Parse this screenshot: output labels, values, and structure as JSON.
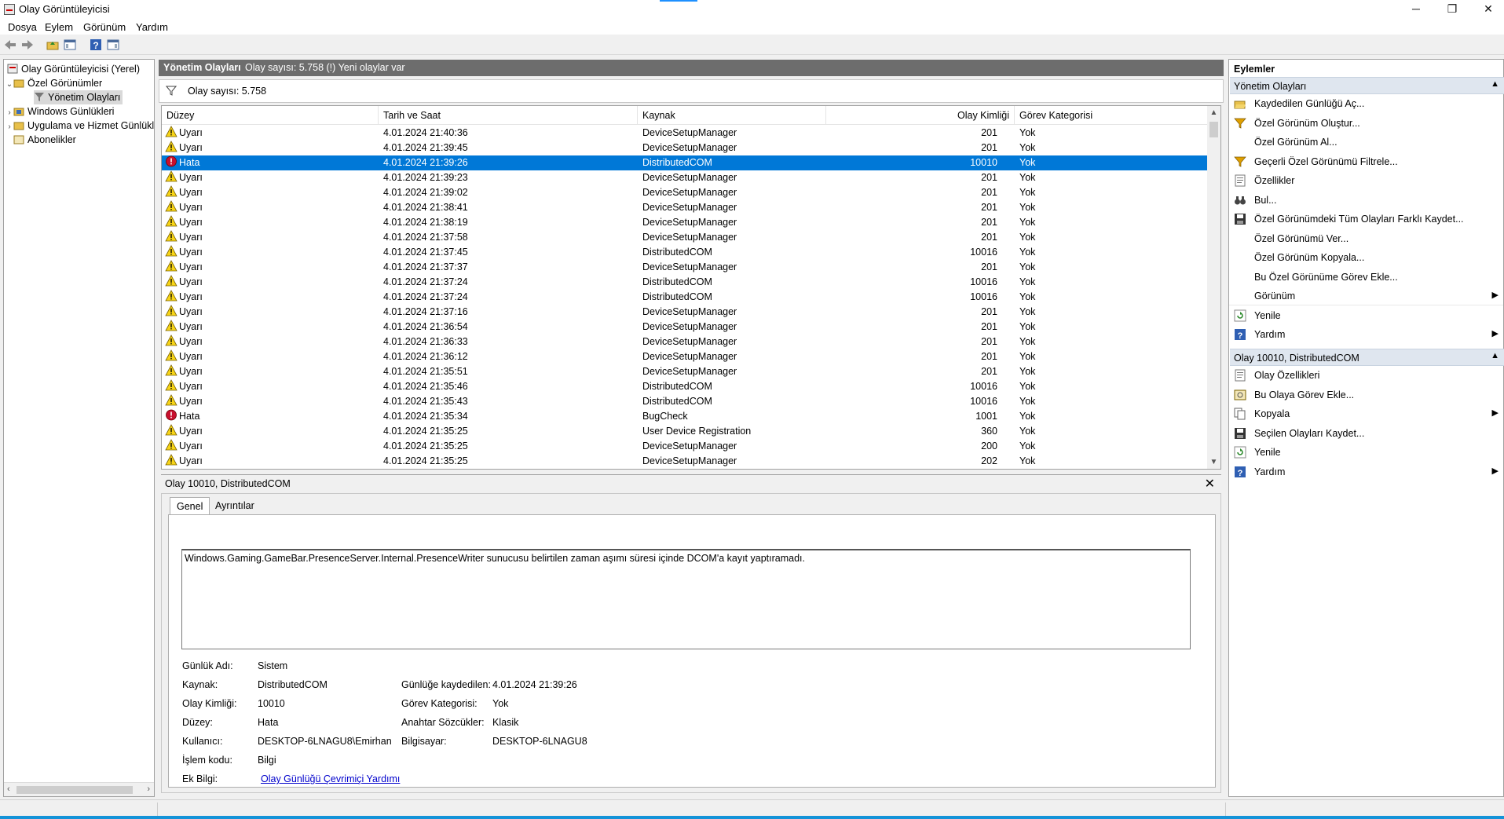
{
  "window": {
    "title": "Olay Görüntüleyicisi",
    "minimize": "─",
    "restore": "❐",
    "close": "✕"
  },
  "menu": [
    "Dosya",
    "Eylem",
    "Görünüm",
    "Yardım"
  ],
  "tree": {
    "root": "Olay Görüntüleyicisi (Yerel)",
    "custom_views": "Özel Görünümler",
    "admin_events": "Yönetim Olayları",
    "windows_logs": "Windows Günlükleri",
    "app_service_logs": "Uygulama ve Hizmet Günlükl",
    "subscriptions": "Abonelikler"
  },
  "center": {
    "header_title": "Yönetim Olayları",
    "header_count": "Olay sayısı: 5.758 (!) Yeni olaylar var",
    "filter_text": "Olay sayısı: 5.758",
    "columns": {
      "level": "Düzey",
      "datetime": "Tarih ve Saat",
      "source": "Kaynak",
      "event_id": "Olay Kimliği",
      "task": "Görev Kategorisi"
    },
    "rows": [
      {
        "level": "Uyarı",
        "type": "warn",
        "datetime": "4.01.2024 21:40:36",
        "source": "DeviceSetupManager",
        "id": "201",
        "task": "Yok"
      },
      {
        "level": "Uyarı",
        "type": "warn",
        "datetime": "4.01.2024 21:39:45",
        "source": "DeviceSetupManager",
        "id": "201",
        "task": "Yok"
      },
      {
        "level": "Hata",
        "type": "error",
        "datetime": "4.01.2024 21:39:26",
        "source": "DistributedCOM",
        "id": "10010",
        "task": "Yok",
        "selected": true
      },
      {
        "level": "Uyarı",
        "type": "warn",
        "datetime": "4.01.2024 21:39:23",
        "source": "DeviceSetupManager",
        "id": "201",
        "task": "Yok"
      },
      {
        "level": "Uyarı",
        "type": "warn",
        "datetime": "4.01.2024 21:39:02",
        "source": "DeviceSetupManager",
        "id": "201",
        "task": "Yok"
      },
      {
        "level": "Uyarı",
        "type": "warn",
        "datetime": "4.01.2024 21:38:41",
        "source": "DeviceSetupManager",
        "id": "201",
        "task": "Yok"
      },
      {
        "level": "Uyarı",
        "type": "warn",
        "datetime": "4.01.2024 21:38:19",
        "source": "DeviceSetupManager",
        "id": "201",
        "task": "Yok"
      },
      {
        "level": "Uyarı",
        "type": "warn",
        "datetime": "4.01.2024 21:37:58",
        "source": "DeviceSetupManager",
        "id": "201",
        "task": "Yok"
      },
      {
        "level": "Uyarı",
        "type": "warn",
        "datetime": "4.01.2024 21:37:45",
        "source": "DistributedCOM",
        "id": "10016",
        "task": "Yok"
      },
      {
        "level": "Uyarı",
        "type": "warn",
        "datetime": "4.01.2024 21:37:37",
        "source": "DeviceSetupManager",
        "id": "201",
        "task": "Yok"
      },
      {
        "level": "Uyarı",
        "type": "warn",
        "datetime": "4.01.2024 21:37:24",
        "source": "DistributedCOM",
        "id": "10016",
        "task": "Yok"
      },
      {
        "level": "Uyarı",
        "type": "warn",
        "datetime": "4.01.2024 21:37:24",
        "source": "DistributedCOM",
        "id": "10016",
        "task": "Yok"
      },
      {
        "level": "Uyarı",
        "type": "warn",
        "datetime": "4.01.2024 21:37:16",
        "source": "DeviceSetupManager",
        "id": "201",
        "task": "Yok"
      },
      {
        "level": "Uyarı",
        "type": "warn",
        "datetime": "4.01.2024 21:36:54",
        "source": "DeviceSetupManager",
        "id": "201",
        "task": "Yok"
      },
      {
        "level": "Uyarı",
        "type": "warn",
        "datetime": "4.01.2024 21:36:33",
        "source": "DeviceSetupManager",
        "id": "201",
        "task": "Yok"
      },
      {
        "level": "Uyarı",
        "type": "warn",
        "datetime": "4.01.2024 21:36:12",
        "source": "DeviceSetupManager",
        "id": "201",
        "task": "Yok"
      },
      {
        "level": "Uyarı",
        "type": "warn",
        "datetime": "4.01.2024 21:35:51",
        "source": "DeviceSetupManager",
        "id": "201",
        "task": "Yok"
      },
      {
        "level": "Uyarı",
        "type": "warn",
        "datetime": "4.01.2024 21:35:46",
        "source": "DistributedCOM",
        "id": "10016",
        "task": "Yok"
      },
      {
        "level": "Uyarı",
        "type": "warn",
        "datetime": "4.01.2024 21:35:43",
        "source": "DistributedCOM",
        "id": "10016",
        "task": "Yok"
      },
      {
        "level": "Hata",
        "type": "error",
        "datetime": "4.01.2024 21:35:34",
        "source": "BugCheck",
        "id": "1001",
        "task": "Yok"
      },
      {
        "level": "Uyarı",
        "type": "warn",
        "datetime": "4.01.2024 21:35:25",
        "source": "User Device Registration",
        "id": "360",
        "task": "Yok"
      },
      {
        "level": "Uyarı",
        "type": "warn",
        "datetime": "4.01.2024 21:35:25",
        "source": "DeviceSetupManager",
        "id": "200",
        "task": "Yok"
      },
      {
        "level": "Uyarı",
        "type": "warn",
        "datetime": "4.01.2024 21:35:25",
        "source": "DeviceSetupManager",
        "id": "202",
        "task": "Yok"
      }
    ]
  },
  "detail": {
    "title": "Olay 10010, DistributedCOM",
    "tab_general": "Genel",
    "tab_details": "Ayrıntılar",
    "description": "Windows.Gaming.GameBar.PresenceServer.Internal.PresenceWriter sunucusu belirtilen zaman aşımı süresi içinde DCOM'a kayıt yaptıramadı.",
    "fields": {
      "log_name_label": "Günlük Adı:",
      "log_name": "Sistem",
      "source_label": "Kaynak:",
      "source": "DistributedCOM",
      "logged_label": "Günlüğe kaydedilen:",
      "logged": "4.01.2024 21:39:26",
      "event_id_label": "Olay Kimliği:",
      "event_id": "10010",
      "task_label": "Görev Kategorisi:",
      "task": "Yok",
      "level_label": "Düzey:",
      "level": "Hata",
      "keywords_label": "Anahtar Sözcükler:",
      "keywords": "Klasik",
      "user_label": "Kullanıcı:",
      "user": "DESKTOP-6LNAGU8\\Emirhan",
      "computer_label": "Bilgisayar:",
      "computer": "DESKTOP-6LNAGU8",
      "opcode_label": "İşlem kodu:",
      "opcode": "Bilgi",
      "more_info_label": "Ek Bilgi:",
      "more_info_link": "Olay Günlüğü Çevrimiçi Yardımı"
    }
  },
  "actions": {
    "title": "Eylemler",
    "section1": "Yönetim Olayları",
    "items1": [
      {
        "label": "Kaydedilen Günlüğü Aç...",
        "icon": "folder-open-icon"
      },
      {
        "label": "Özel Görünüm Oluştur...",
        "icon": "filter-icon"
      },
      {
        "label": "Özel Görünüm Al...",
        "icon": "none"
      },
      {
        "label": "Geçerli Özel Görünümü Filtrele...",
        "icon": "filter-icon"
      },
      {
        "label": "Özellikler",
        "icon": "properties-icon"
      },
      {
        "label": "Bul...",
        "icon": "binoculars-icon"
      },
      {
        "label": "Özel Görünümdeki Tüm Olayları Farklı Kaydet...",
        "icon": "save-icon"
      },
      {
        "label": "Özel Görünümü Ver...",
        "icon": "none"
      },
      {
        "label": "Özel Görünüm Kopyala...",
        "icon": "none"
      },
      {
        "label": "Bu Özel Görünüme Görev Ekle...",
        "icon": "none"
      },
      {
        "label": "Görünüm",
        "icon": "none",
        "submenu": true
      },
      {
        "label": "Yenile",
        "icon": "refresh-icon"
      },
      {
        "label": "Yardım",
        "icon": "help-icon",
        "submenu": true
      }
    ],
    "section2": "Olay 10010, DistributedCOM",
    "items2": [
      {
        "label": "Olay Özellikleri",
        "icon": "properties-icon"
      },
      {
        "label": "Bu Olaya Görev Ekle...",
        "icon": "task-icon"
      },
      {
        "label": "Kopyala",
        "icon": "copy-icon",
        "submenu": true
      },
      {
        "label": "Seçilen Olayları Kaydet...",
        "icon": "save-icon"
      },
      {
        "label": "Yenile",
        "icon": "refresh-icon"
      },
      {
        "label": "Yardım",
        "icon": "help-icon",
        "submenu": true
      }
    ]
  },
  "colors": {
    "selection": "#0078d7",
    "header_grey": "#6d6d6d",
    "section_blue": "#dfe6ef",
    "warning_yellow": "#f7d417",
    "error_red": "#c8102e"
  }
}
